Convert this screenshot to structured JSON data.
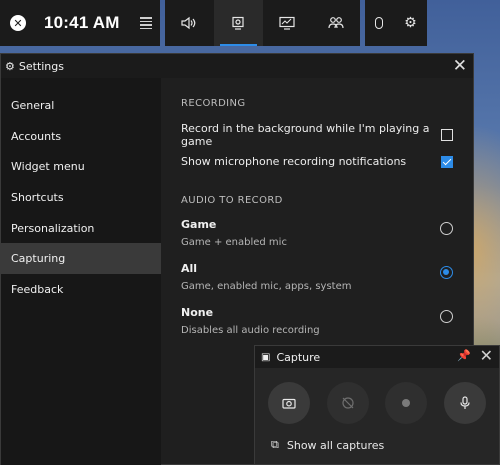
{
  "gamebar": {
    "time": "10:41 AM"
  },
  "settings": {
    "title": "Settings",
    "nav": [
      {
        "label": "General"
      },
      {
        "label": "Accounts"
      },
      {
        "label": "Widget menu"
      },
      {
        "label": "Shortcuts"
      },
      {
        "label": "Personalization"
      },
      {
        "label": "Capturing"
      },
      {
        "label": "Feedback"
      }
    ],
    "active_nav": "Capturing",
    "recording": {
      "title": "RECORDING",
      "background_label": "Record in the background while I'm playing a game",
      "background_checked": false,
      "mic_notify_label": "Show microphone recording notifications",
      "mic_notify_checked": true
    },
    "audio": {
      "title": "AUDIO TO RECORD",
      "options": [
        {
          "name": "Game",
          "desc": "Game + enabled mic",
          "selected": false
        },
        {
          "name": "All",
          "desc": "Game, enabled mic, apps, system",
          "selected": true
        },
        {
          "name": "None",
          "desc": "Disables all audio recording",
          "selected": false
        }
      ]
    }
  },
  "capture": {
    "title": "Capture",
    "show_all_label": "Show all captures"
  },
  "colors": {
    "accent": "#2d8ce8",
    "panel": "#1f1f1f",
    "nav": "#171717"
  }
}
